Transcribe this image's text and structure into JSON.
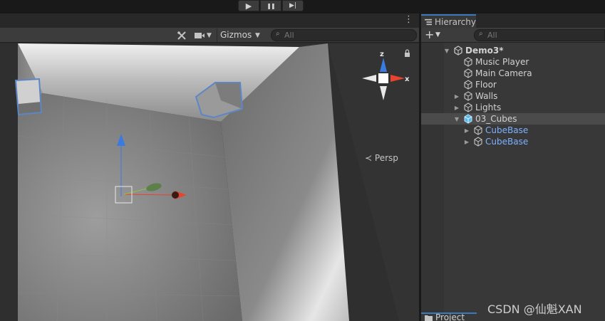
{
  "playbar": {
    "play_icon": "play-icon",
    "pause_icon": "pause-icon",
    "step_icon": "step-icon",
    "play_glyph": "▶",
    "pause_glyph": "❚❚",
    "step_glyph": "▶|"
  },
  "scene": {
    "menu_glyph": "⋮",
    "toolbar": {
      "tools_glyph": "✂",
      "camera_glyph": "■",
      "dropdown_glyph": "▼",
      "gizmos_label": "Gizmos",
      "search_placeholder": "All",
      "search_glyph": "⌕"
    },
    "gizmo": {
      "axis_z": "z",
      "axis_x": "x",
      "persp_label": "Persp",
      "persp_glyph": "≺"
    },
    "colors": {
      "axis_x": "#e8432d",
      "axis_y": "#8cc34a",
      "axis_z": "#3a7be0",
      "selection_outline": "#5d86c4"
    }
  },
  "hierarchy": {
    "tab_label": "Hierarchy",
    "add_glyph": "+",
    "dropdown_glyph": "▼",
    "search_placeholder": "All",
    "search_glyph": "⌕",
    "items": [
      {
        "label": "Demo3*",
        "depth": 0,
        "foldout": "expanded",
        "icon": "unity-scene-icon",
        "bold": true,
        "prefab": false,
        "selected": false
      },
      {
        "label": "Music Player",
        "depth": 1,
        "foldout": "none",
        "icon": "gameobject-icon",
        "bold": false,
        "prefab": false,
        "selected": false
      },
      {
        "label": "Main Camera",
        "depth": 1,
        "foldout": "none",
        "icon": "gameobject-icon",
        "bold": false,
        "prefab": false,
        "selected": false
      },
      {
        "label": "Floor",
        "depth": 1,
        "foldout": "none",
        "icon": "gameobject-icon",
        "bold": false,
        "prefab": false,
        "selected": false
      },
      {
        "label": "Walls",
        "depth": 1,
        "foldout": "collapsed",
        "icon": "gameobject-icon",
        "bold": false,
        "prefab": false,
        "selected": false
      },
      {
        "label": "Lights",
        "depth": 1,
        "foldout": "collapsed",
        "icon": "gameobject-icon",
        "bold": false,
        "prefab": false,
        "selected": false
      },
      {
        "label": "03_Cubes",
        "depth": 1,
        "foldout": "expanded",
        "icon": "gameobject-selected-icon",
        "bold": false,
        "prefab": false,
        "selected": true
      },
      {
        "label": "CubeBase",
        "depth": 2,
        "foldout": "collapsed",
        "icon": "gameobject-icon",
        "bold": false,
        "prefab": true,
        "selected": false
      },
      {
        "label": "CubeBase",
        "depth": 2,
        "foldout": "collapsed",
        "icon": "gameobject-icon",
        "bold": false,
        "prefab": true,
        "selected": false
      }
    ]
  },
  "project": {
    "tab_label": "Project"
  },
  "watermark": "CSDN @仙魁XAN"
}
